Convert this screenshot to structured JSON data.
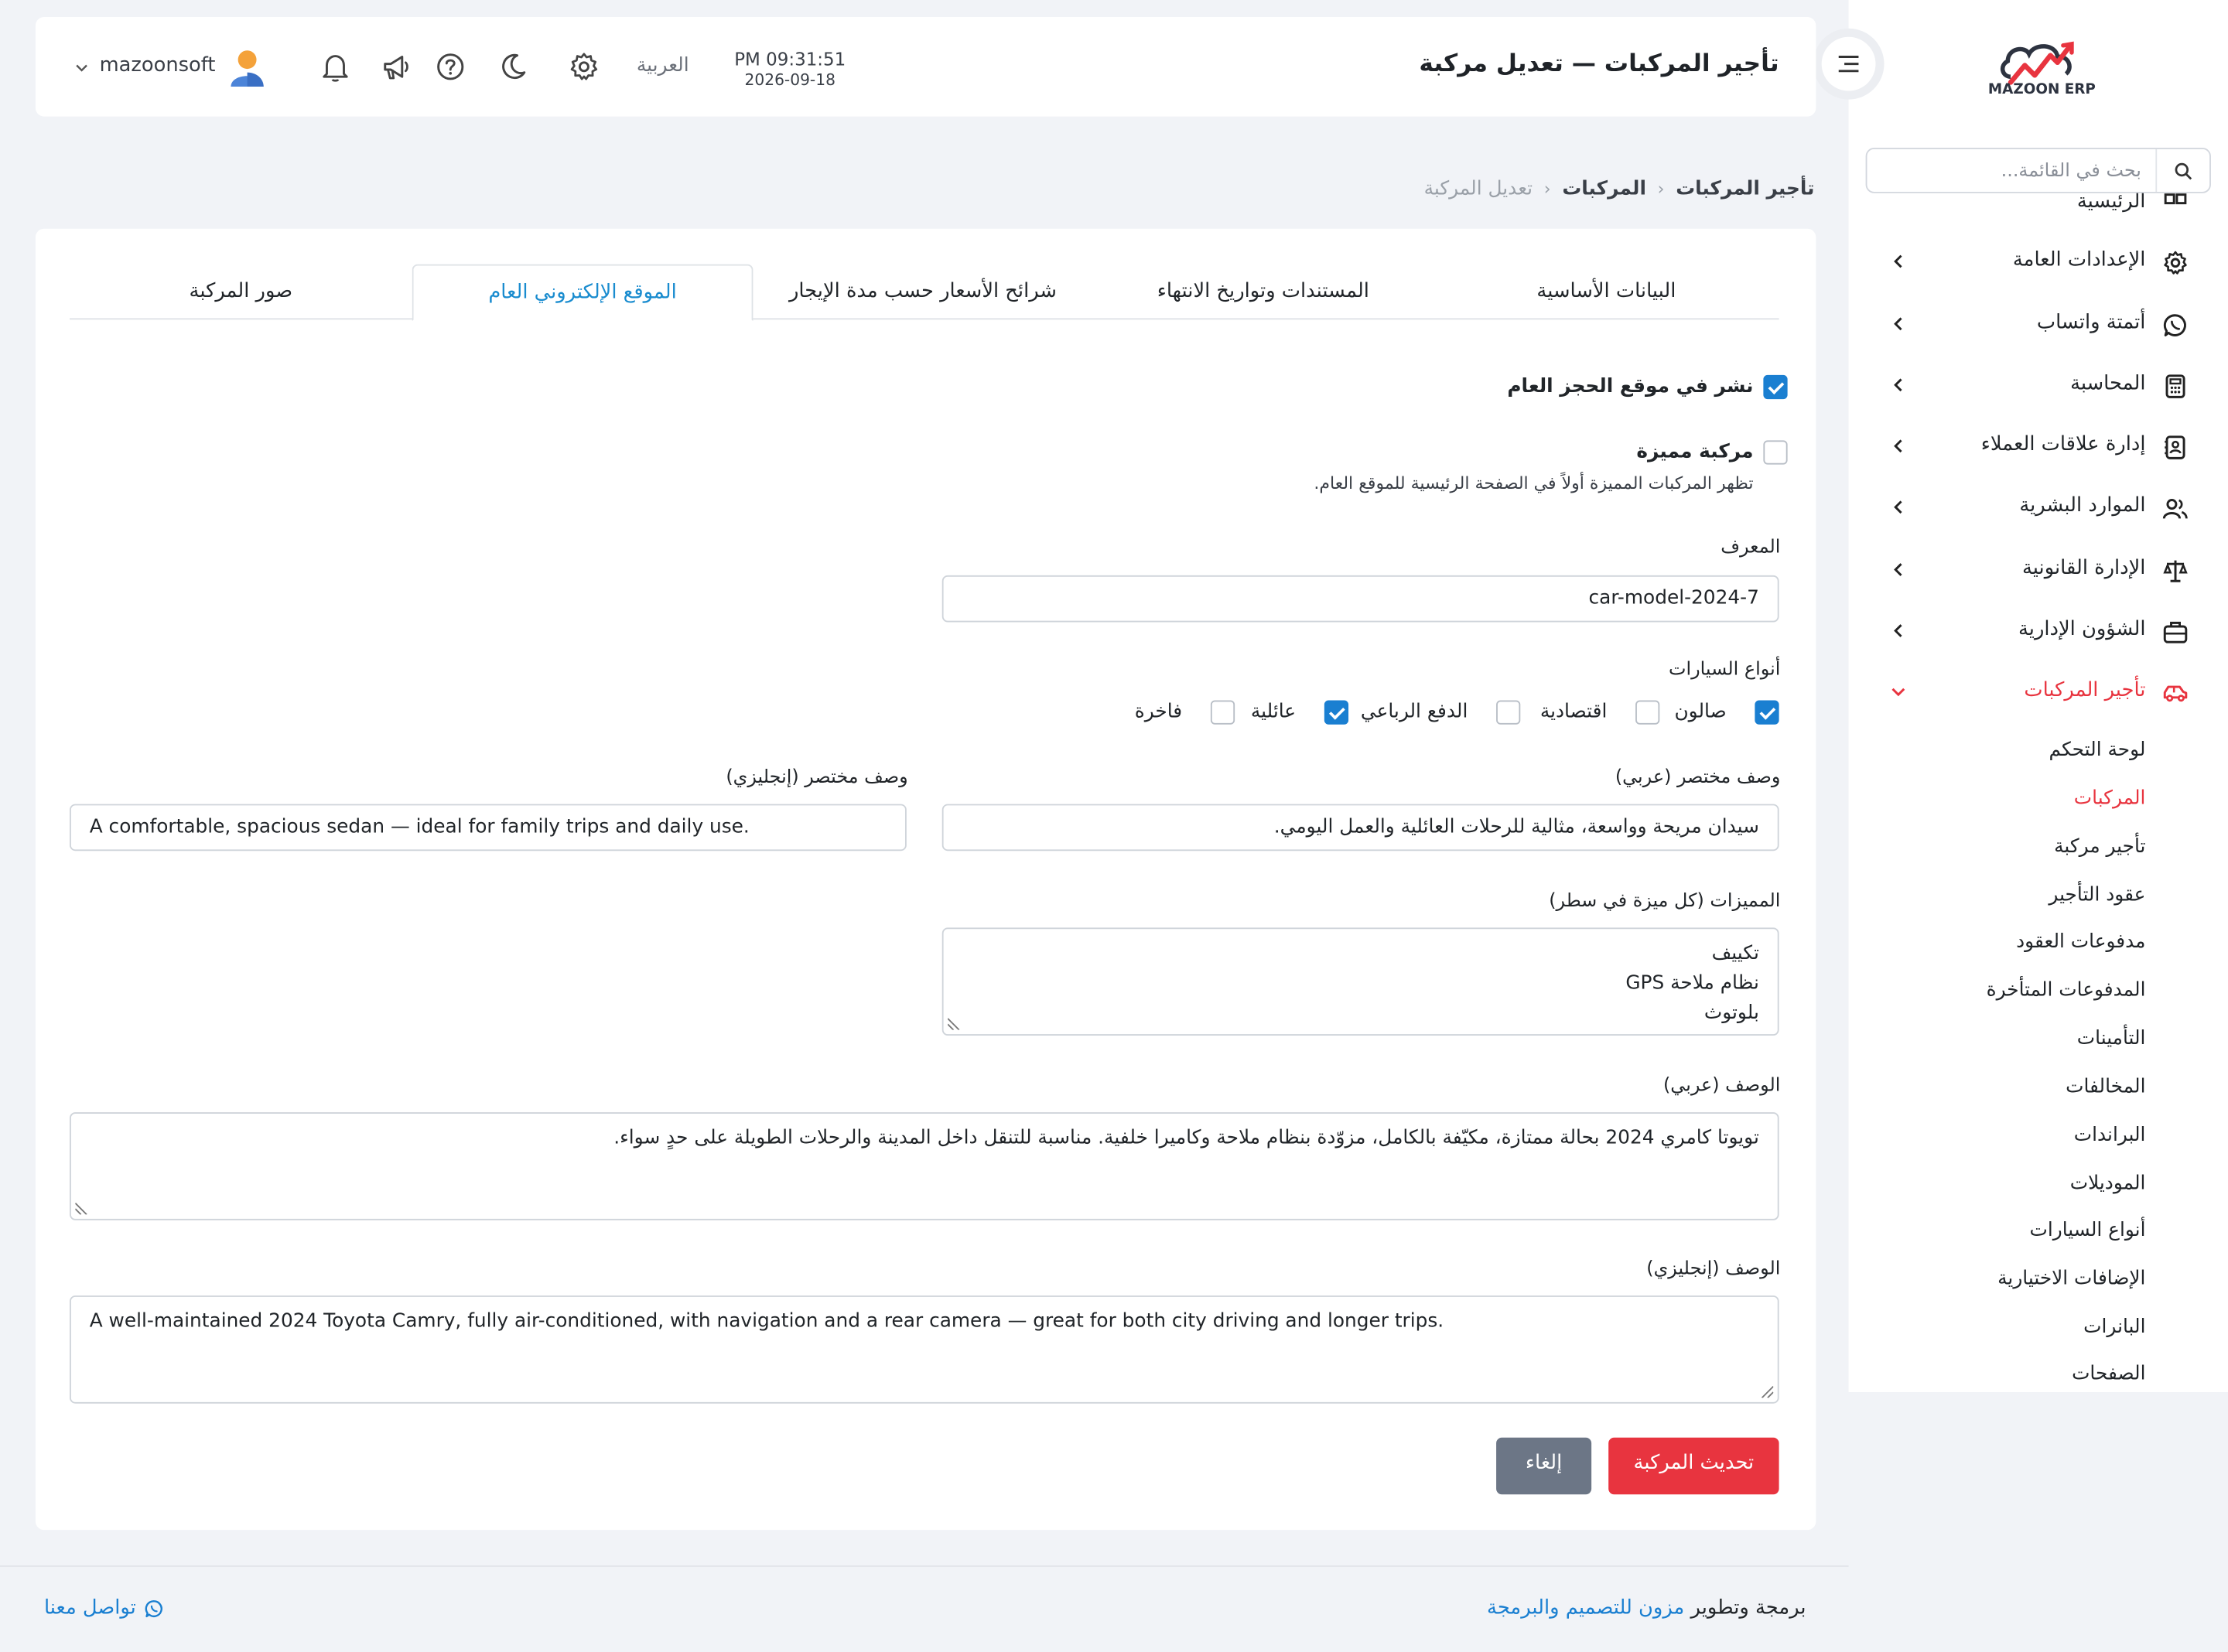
{
  "app": {
    "logo_text": "MAZOON ERP",
    "page_title": "تأجير المركبات — تعديل مركبة",
    "time": "PM 09:31:51",
    "date": "2026-09-18",
    "language": "العربية",
    "user_name": "mazoonsoft"
  },
  "sidebar": {
    "search_placeholder": "بحث في القائمة...",
    "items": [
      {
        "label": "الرئيسية",
        "icon": "home-icon"
      },
      {
        "label": "الإعدادات العامة",
        "icon": "gear-icon"
      },
      {
        "label": "أتمتة واتساب",
        "icon": "whatsapp-icon"
      },
      {
        "label": "المحاسبة",
        "icon": "calculator-icon"
      },
      {
        "label": "إدارة علاقات العملاء",
        "icon": "contacts-icon"
      },
      {
        "label": "الموارد البشرية",
        "icon": "users-icon"
      },
      {
        "label": "الإدارة القانونية",
        "icon": "scale-icon"
      },
      {
        "label": "الشؤون الإدارية",
        "icon": "briefcase-icon"
      },
      {
        "label": "تأجير المركبات",
        "icon": "car-icon"
      }
    ],
    "sub_items": [
      "لوحة التحكم",
      "المركبات",
      "تأجير مركبة",
      "عقود التأجير",
      "مدفوعات العقود",
      "المدفوعات المتأخرة",
      "التأمينات",
      "المخالفات",
      "البراندات",
      "الموديلات",
      "أنواع السيارات",
      "الإضافات الاختيارية",
      "البانرات",
      "الصفحات"
    ]
  },
  "breadcrumb": [
    "تأجير المركبات",
    "المركبات",
    "تعديل المركبة"
  ],
  "tabs": [
    "البيانات الأساسية",
    "المستندات وتواريخ الانتهاء",
    "شرائح الأسعار حسب مدة الإيجار",
    "الموقع الإلكتروني العام",
    "صور المركبة"
  ],
  "form": {
    "publish_label": "نشر في موقع الحجز العام",
    "publish_checked": true,
    "featured_label": "مركبة مميزة",
    "featured_checked": false,
    "featured_hint": "تظهر المركبات المميزة أولاً في الصفحة الرئيسية للموقع العام.",
    "slug_label": "المعرف",
    "slug_value": "car-model-2024-7",
    "car_types_label": "أنواع السيارات",
    "car_types": [
      {
        "label": "صالون",
        "checked": true
      },
      {
        "label": "اقتصادية",
        "checked": false
      },
      {
        "label": "الدفع الرباعي",
        "checked": false
      },
      {
        "label": "عائلية",
        "checked": true
      },
      {
        "label": "فاخرة",
        "checked": false
      }
    ],
    "short_desc_ar_label": "وصف مختصر (عربي)",
    "short_desc_ar": "سيدان مريحة وواسعة، مثالية للرحلات العائلية والعمل اليومي.",
    "short_desc_en_label": "وصف مختصر (إنجليزي)",
    "short_desc_en": "A comfortable, spacious sedan — ideal for family trips and daily use.",
    "features_label": "المميزات (كل ميزة في سطر)",
    "features": [
      "تكييف",
      "نظام ملاحة GPS",
      "بلوتوث"
    ],
    "desc_ar_label": "الوصف (عربي)",
    "desc_ar": "تويوتا كامري 2024 بحالة ممتازة، مكيّفة بالكامل، مزوّدة بنظام ملاحة وكاميرا خلفية. مناسبة للتنقل داخل المدينة والرحلات الطويلة على حدٍ سواء.",
    "desc_en_label": "الوصف (إنجليزي)",
    "desc_en": "A well-maintained 2024 Toyota Camry, fully air-conditioned, with navigation and a rear camera — great for both city driving and longer trips.",
    "submit_label": "تحديث المركبة",
    "cancel_label": "إلغاء"
  },
  "footer": {
    "credit_prefix": "برمجة وتطوير",
    "credit_link": "مزون للتصميم والبرمجة",
    "contact_label": "تواصل معنا"
  },
  "colors": {
    "accent": "#e8343f",
    "link": "#1a7fd1",
    "tab_active": "#1a8ccf",
    "checkbox": "#1a7fd1",
    "cancel_button": "#6c7686"
  }
}
